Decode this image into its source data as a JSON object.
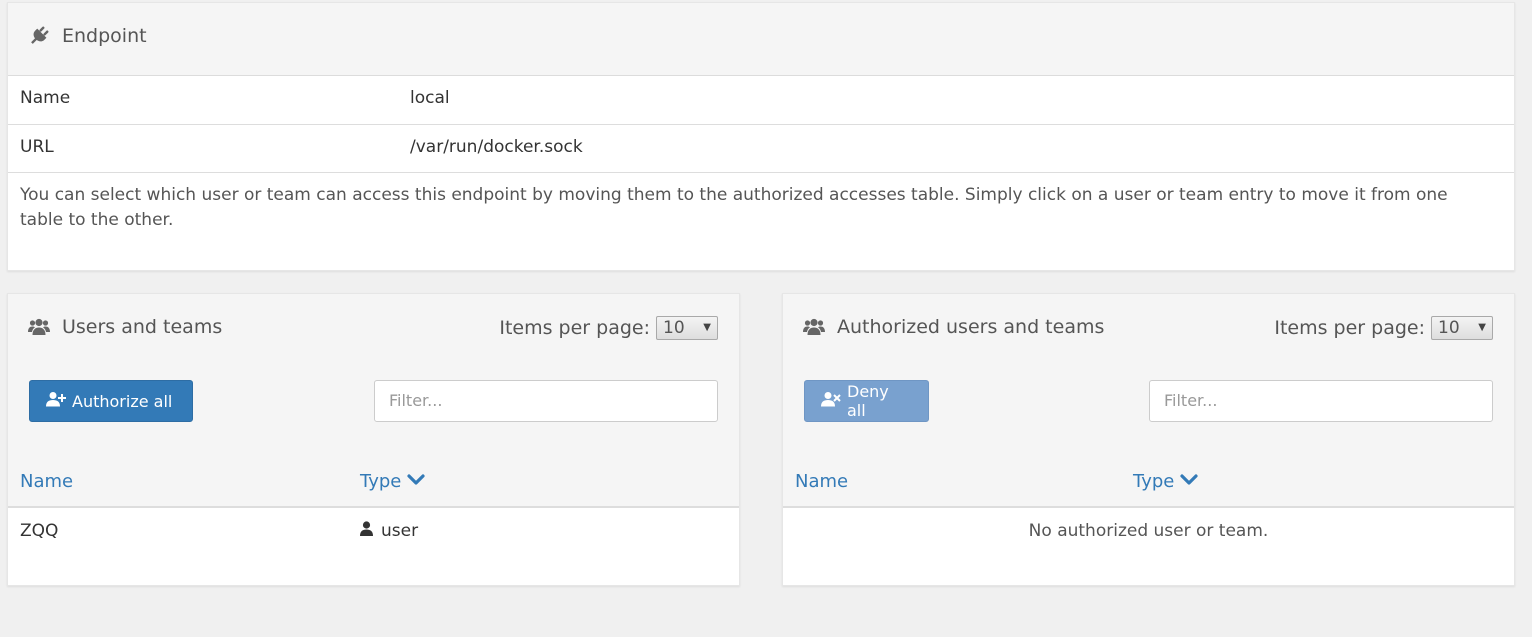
{
  "endpoint": {
    "title": "Endpoint",
    "icon": "plug-icon",
    "rows": [
      {
        "label": "Name",
        "value": "local"
      },
      {
        "label": "URL",
        "value": "/var/run/docker.sock"
      }
    ],
    "description": "You can select which user or team can access this endpoint by moving them to the authorized accesses table. Simply click on a user or team entry to move it from one table to the other."
  },
  "users_panel": {
    "title": "Users and teams",
    "icon": "users-icon",
    "items_per_page_label": "Items per page:",
    "items_per_page_value": "10",
    "action_button": "Authorize all",
    "filter_placeholder": "Filter...",
    "columns": [
      "Name",
      "Type"
    ],
    "rows": [
      {
        "name": "ZQQ",
        "type": "user",
        "type_icon": "user-icon"
      }
    ]
  },
  "authorized_panel": {
    "title": "Authorized users and teams",
    "icon": "users-icon",
    "items_per_page_label": "Items per page:",
    "items_per_page_value": "10",
    "action_button": "Deny all",
    "filter_placeholder": "Filter...",
    "columns": [
      "Name",
      "Type"
    ],
    "empty_message": "No authorized user or team."
  },
  "colors": {
    "primary": "#337ab7",
    "primary_disabled": "#79a1cf",
    "link": "#337ab7"
  }
}
